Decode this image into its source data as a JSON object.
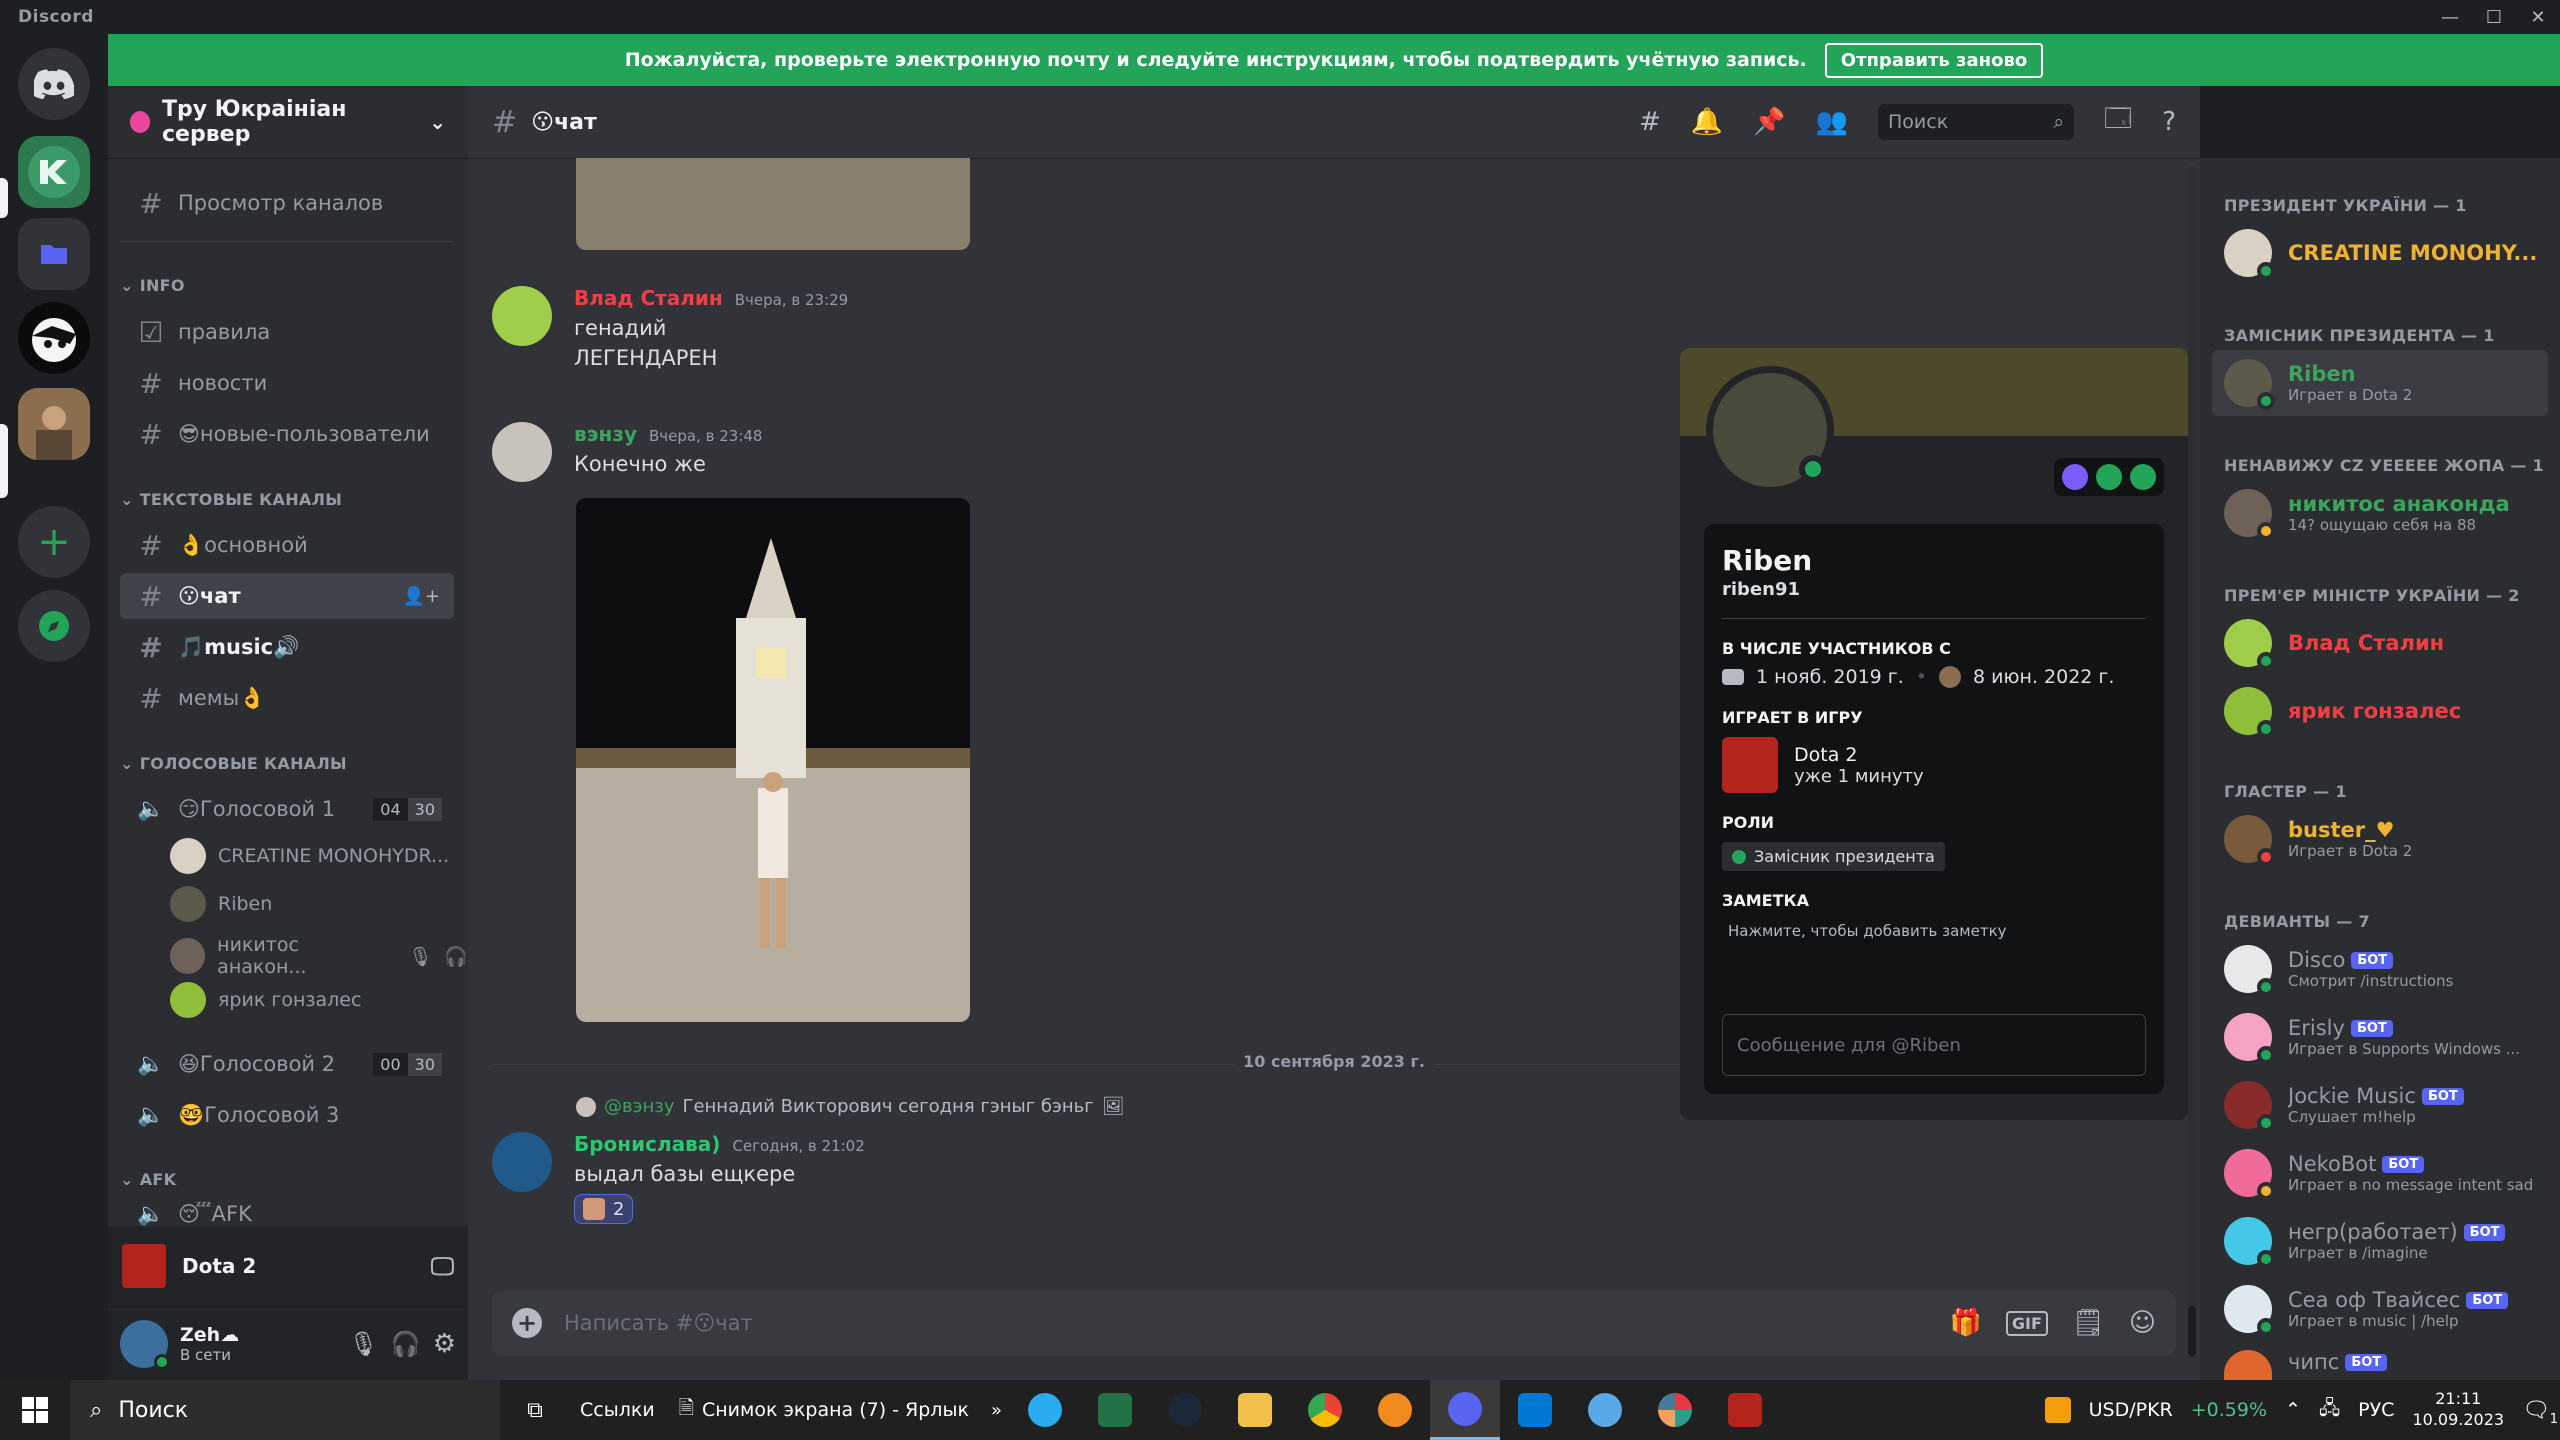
{
  "titlebar": {
    "app_name": "Discord",
    "min": "—",
    "max": "☐",
    "close": "✕"
  },
  "banner": {
    "text": "Пожалуйста, проверьте электронную почту и следуйте инструкциям, чтобы подтвердить учётную запись.",
    "button": "Отправить заново"
  },
  "server": {
    "name": "Тру Юкраініан сервер",
    "browse_channels": "Просмотр каналов"
  },
  "categories": {
    "info": "INFO",
    "text": "ТЕКСТОВЫЕ КАНАЛЫ",
    "voice": "ГОЛОСОВЫЕ КАНАЛЫ",
    "afk": "AFK"
  },
  "channels": {
    "info": [
      "правила",
      "новости",
      "😎новые-пользователи"
    ],
    "text": [
      "👌основной",
      "😗чат",
      "🎵music🔊",
      "мемы👌"
    ],
    "voice1": {
      "name": "😏Голосовой 1",
      "count": "04",
      "limit": "30"
    },
    "voice1_users": [
      "CREATINE MONOHYDR...",
      "Riben",
      "никитос анакон...",
      "ярик гонзалес"
    ],
    "voice2": {
      "name": "😆Голосовой 2",
      "count": "00",
      "limit": "30"
    },
    "voice3": {
      "name": "🤓Голосовой 3"
    },
    "afk": "😴AFK"
  },
  "activity": {
    "game": "Dota 2"
  },
  "user": {
    "name": "Zeh☁",
    "status": "В сети"
  },
  "chat": {
    "channel_name": "😗чат",
    "search_placeholder": "Поиск",
    "messages": [
      {
        "author": "Влад Сталин",
        "color": "#f23f43",
        "time": "Вчера, в 23:29",
        "lines": [
          "генадий",
          "ЛЕГЕНДАРЕН"
        ]
      },
      {
        "author": "вэнзу",
        "color": "#3ba55c",
        "time": "Вчера, в 23:48",
        "lines": [
          "Конечно же"
        ]
      },
      {
        "author": "Бронислава)",
        "color": "#2dc770",
        "time": "Сегодня, в 21:02",
        "lines": [
          "выдал базы ещкере"
        ],
        "reply_author": "@вэнзу",
        "reply_text": "Геннадий Викторович сегодня гэныг бэньг",
        "reaction_count": "2"
      }
    ],
    "date_divider": "10 сентября 2023 г.",
    "composer_placeholder": "Написать #😗чат",
    "gif": "GIF"
  },
  "profile": {
    "display_name": "Riben",
    "username": "riben91",
    "member_since_label": "В ЧИСЛЕ УЧАСТНИКОВ С",
    "discord_since": "1 нояб. 2019 г.",
    "server_since": "8 июн. 2022 г.",
    "playing_label": "ИГРАЕТ В ИГРУ",
    "game": "Dota 2",
    "game_time": "уже 1 минуту",
    "roles_label": "РОЛИ",
    "role": "Замісник президента",
    "note_label": "ЗАМЕТКА",
    "note_placeholder": "Нажмите, чтобы добавить заметку",
    "message_placeholder": "Сообщение для @Riben"
  },
  "members": {
    "groups": [
      {
        "title": "ПРЕЗИДЕНТ УКРАЇНИ — 1"
      },
      {
        "title": "ЗАМІСНИК ПРЕЗИДЕНТА — 1"
      },
      {
        "title": "НЕНАВИЖУ CZ УЕЕЕЕЕ ЖОПА — 1"
      },
      {
        "title": "ПРЕМ'ЄР МІНІСТР УКРАЇНИ — 2"
      },
      {
        "title": "ГЛАСТЕР — 1"
      },
      {
        "title": "ДЕВИАНТЫ — 7"
      }
    ],
    "list": [
      {
        "name": "CREATINE MONOHY...",
        "sub": "",
        "color": "#f0b232"
      },
      {
        "name": "Riben",
        "sub": "Играет в Dota 2",
        "color": "#3ba55c"
      },
      {
        "name": "никитос анаконда",
        "sub": "14? ощущаю себя на 88",
        "color": "#3ba55c"
      },
      {
        "name": "Влад Сталин",
        "sub": "",
        "color": "#f23f43"
      },
      {
        "name": "ярик гонзалес",
        "sub": "",
        "color": "#f23f43"
      },
      {
        "name": "buster_♥",
        "sub": "Играет в Dota 2",
        "color": "#f0b232"
      },
      {
        "name": "Disco",
        "sub": "Смотрит /instructions",
        "color": "#949ba4"
      },
      {
        "name": "Erisly",
        "sub": "Играет в Supports Windows ...",
        "color": "#949ba4"
      },
      {
        "name": "Jockie Music",
        "sub": "Слушает m!help",
        "color": "#949ba4"
      },
      {
        "name": "NekoBot",
        "sub": "Играет в no message intent sad",
        "color": "#949ba4"
      },
      {
        "name": "негр(работает)",
        "sub": "Играет в /imagine",
        "color": "#949ba4"
      },
      {
        "name": "Сеа оф Твайсес",
        "sub": "Играет в music | /help",
        "color": "#949ba4"
      },
      {
        "name": "чипс",
        "sub": "",
        "color": "#949ba4"
      }
    ],
    "bot_label": "БОТ"
  },
  "taskbar": {
    "search": "Поиск",
    "links": "Ссылки",
    "snip": "Снимок экрана (7) - Ярлык",
    "currency": "USD/PKR",
    "currency_change": "+0.59%",
    "lang": "РУС",
    "time": "21:11",
    "date": "10.09.2023",
    "notif_count": "1"
  }
}
